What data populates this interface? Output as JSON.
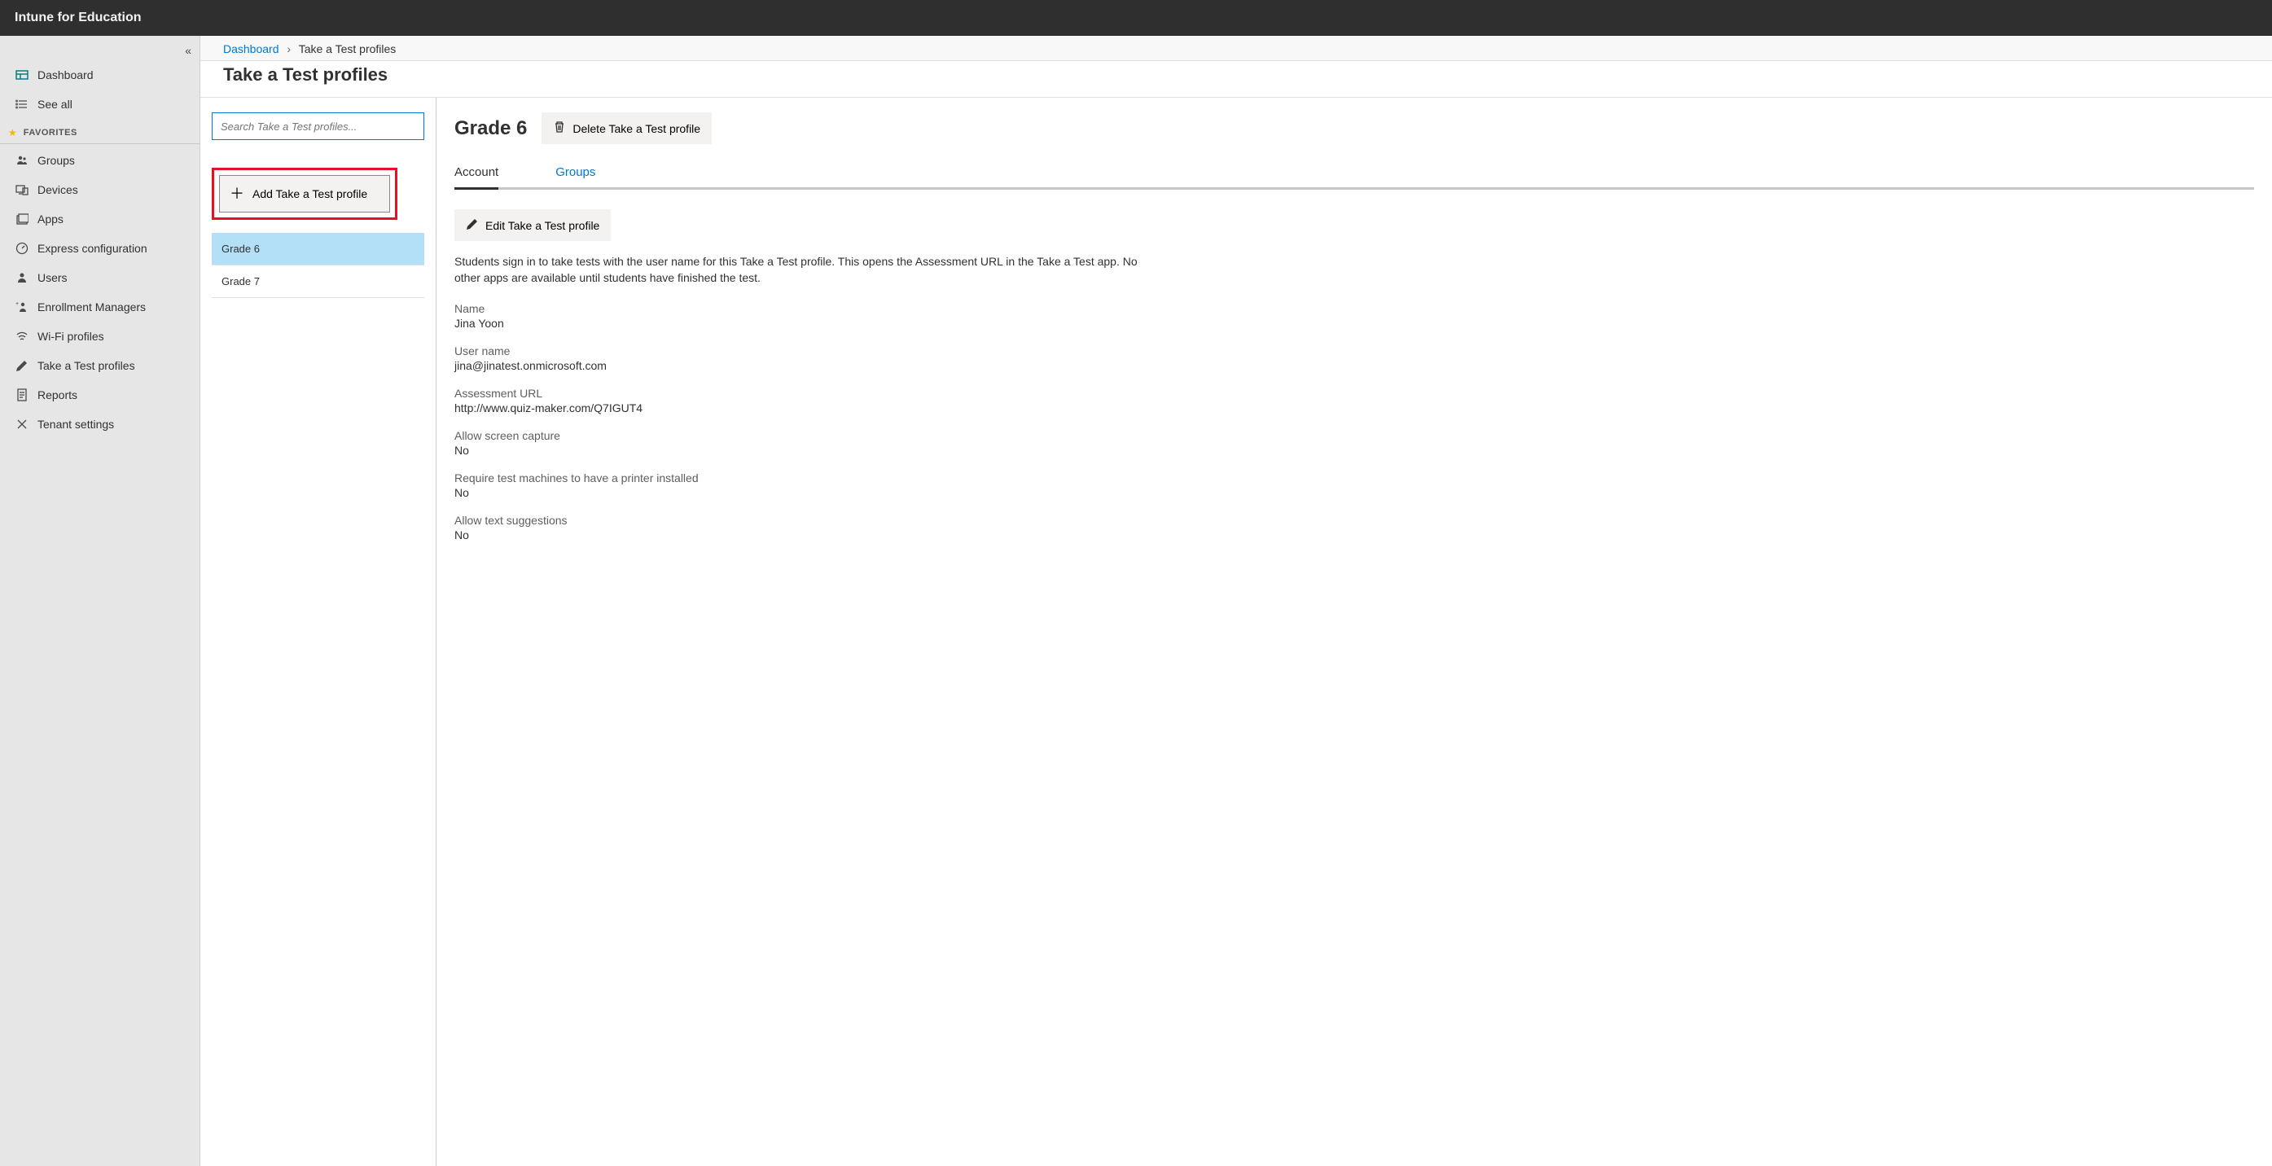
{
  "topbar": {
    "title": "Intune for Education"
  },
  "sidebar": {
    "dashboard": "Dashboard",
    "see_all": "See all",
    "favorites_label": "FAVORITES",
    "items": [
      "Groups",
      "Devices",
      "Apps",
      "Express configuration",
      "Users",
      "Enrollment Managers",
      "Wi-Fi profiles",
      "Take a Test profiles",
      "Reports",
      "Tenant settings"
    ]
  },
  "breadcrumb": {
    "dashboard": "Dashboard",
    "current": "Take a Test profiles"
  },
  "page": {
    "title": "Take a Test profiles"
  },
  "listpane": {
    "search_placeholder": "Search Take a Test profiles...",
    "add_button": "Add Take a Test profile",
    "profiles": [
      "Grade 6",
      "Grade 7"
    ]
  },
  "detail": {
    "title": "Grade 6",
    "delete_button": "Delete Take a Test profile",
    "tabs": {
      "account": "Account",
      "groups": "Groups"
    },
    "edit_button": "Edit Take a Test profile",
    "description": "Students sign in to take tests with the user name for this Take a Test profile. This opens the Assessment URL in the Take a Test app. No other apps are available until students have finished the test.",
    "fields": {
      "name": {
        "label": "Name",
        "value": "Jina Yoon"
      },
      "username": {
        "label": "User name",
        "value": "jina@jinatest.onmicrosoft.com"
      },
      "assessment_url": {
        "label": "Assessment URL",
        "value": "http://www.quiz-maker.com/Q7IGUT4"
      },
      "screen_capture": {
        "label": "Allow screen capture",
        "value": "No"
      },
      "printer": {
        "label": "Require test machines to have a printer installed",
        "value": "No"
      },
      "text_suggestions": {
        "label": "Allow text suggestions",
        "value": "No"
      }
    }
  }
}
